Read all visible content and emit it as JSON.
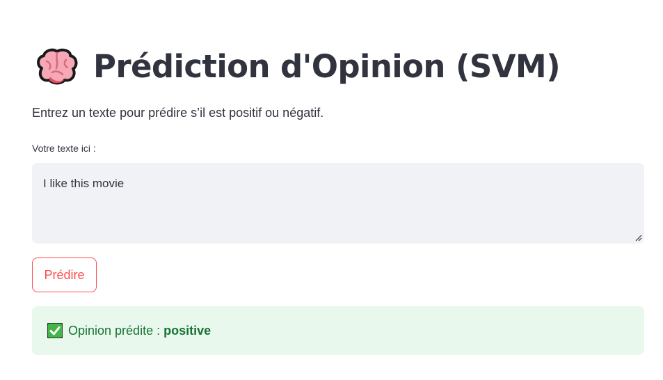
{
  "header": {
    "icon": "brain-icon",
    "title": "Prédiction d'Opinion (SVM)",
    "subtitle": "Entrez un texte pour prédire s’il est positif ou négatif."
  },
  "input": {
    "label": "Votre texte ici :",
    "value": "I like this movie"
  },
  "predict_button": {
    "label": "Prédire"
  },
  "result": {
    "icon": "check-mark-icon",
    "label": "Opinion prédite :",
    "value": "positive"
  },
  "colors": {
    "accent": "#ff4b4b",
    "text": "#31333f",
    "input_bg": "#f0f2f6",
    "success_bg": "#e8f8ec",
    "success_text": "#177233"
  }
}
